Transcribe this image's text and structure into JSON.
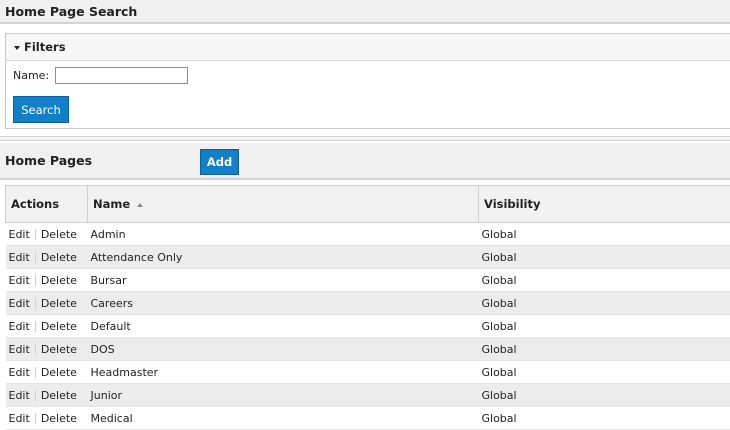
{
  "search_panel": {
    "title": "Home Page Search"
  },
  "filters": {
    "title": "Filters",
    "name_label": "Name:",
    "name_value": "",
    "search_label": "Search"
  },
  "home_pages": {
    "title": "Home Pages",
    "add_label": "Add",
    "columns": {
      "actions": "Actions",
      "name": "Name",
      "visibility": "Visibility"
    },
    "edit_label": "Edit",
    "delete_label": "Delete",
    "rows": [
      {
        "name": "Admin",
        "visibility": "Global"
      },
      {
        "name": "Attendance Only",
        "visibility": "Global"
      },
      {
        "name": "Bursar",
        "visibility": "Global"
      },
      {
        "name": "Careers",
        "visibility": "Global"
      },
      {
        "name": "Default",
        "visibility": "Global"
      },
      {
        "name": "DOS",
        "visibility": "Global"
      },
      {
        "name": "Headmaster",
        "visibility": "Global"
      },
      {
        "name": "Junior",
        "visibility": "Global"
      },
      {
        "name": "Medical",
        "visibility": "Global"
      }
    ]
  }
}
